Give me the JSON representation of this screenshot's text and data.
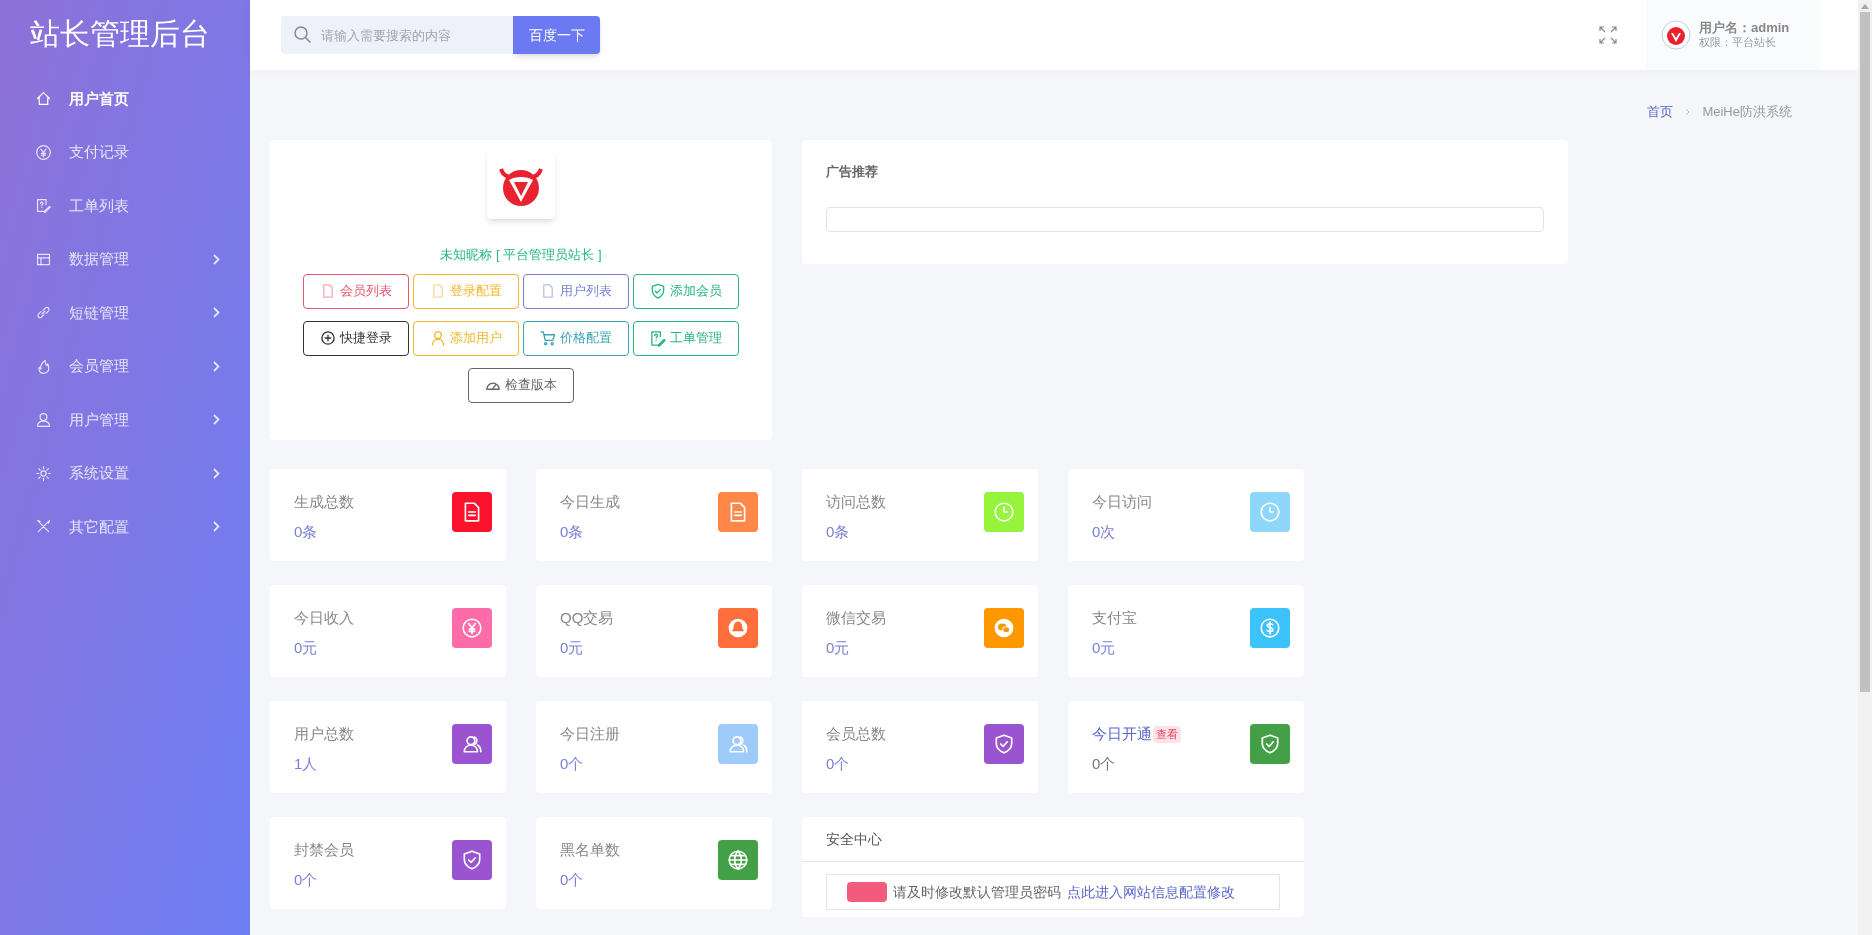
{
  "sidebar": {
    "title": "站长管理后台",
    "items": [
      {
        "label": "用户首页",
        "selected": true,
        "expandable": false
      },
      {
        "label": "支付记录",
        "selected": false,
        "expandable": false
      },
      {
        "label": "工单列表",
        "selected": false,
        "expandable": false
      },
      {
        "label": "数据管理",
        "selected": false,
        "expandable": true
      },
      {
        "label": "短链管理",
        "selected": false,
        "expandable": true
      },
      {
        "label": "会员管理",
        "selected": false,
        "expandable": true
      },
      {
        "label": "用户管理",
        "selected": false,
        "expandable": true
      },
      {
        "label": "系统设置",
        "selected": false,
        "expandable": true
      },
      {
        "label": "其它配置",
        "selected": false,
        "expandable": true
      }
    ]
  },
  "header": {
    "search": {
      "placeholder": "请输入需要搜索的内容"
    },
    "search_button": "百度一下",
    "user": {
      "name_line": "用户名：admin",
      "role_line": "权限：平台站长"
    }
  },
  "breadcrumb": [
    "首页",
    "MeiHe防洪系统"
  ],
  "profile": {
    "nickname": "未知昵称 [ 平台管理员站长 ]",
    "buttons": [
      {
        "label": "会员列表",
        "color": "#e5586f"
      },
      {
        "label": "登录配置",
        "color": "#f3b62a"
      },
      {
        "label": "用户列表",
        "color": "#7b7fd8"
      },
      {
        "label": "添加会员",
        "color": "#27b584"
      },
      {
        "label": "快捷登录",
        "color": "#333333"
      },
      {
        "label": "添加用户",
        "color": "#f3b62a"
      },
      {
        "label": "价格配置",
        "color": "#3aa5b8"
      },
      {
        "label": "工单管理",
        "color": "#27b584"
      },
      {
        "label": "检查版本",
        "color": "#666666"
      }
    ]
  },
  "ad_panel": {
    "title": "广告推荐"
  },
  "stats": [
    {
      "label": "生成总数",
      "value": "0条",
      "color": "#f9132d",
      "kind": "plain"
    },
    {
      "label": "今日生成",
      "value": "0条",
      "color": "#ff8748",
      "kind": "plain"
    },
    {
      "label": "访问总数",
      "value": "0条",
      "color": "#96f43c",
      "kind": "plain"
    },
    {
      "label": "今日访问",
      "value": "0次",
      "color": "#8fd6fb",
      "kind": "plain"
    },
    {
      "label": "今日收入",
      "value": "0元",
      "color": "#fb6ca8",
      "kind": "plain"
    },
    {
      "label": "QQ交易",
      "value": "0元",
      "color": "#ff6e3c",
      "kind": "plain"
    },
    {
      "label": "微信交易",
      "value": "0元",
      "color": "#ff9800",
      "kind": "plain"
    },
    {
      "label": "支付宝",
      "value": "0元",
      "color": "#3cc3fb",
      "kind": "plain"
    },
    {
      "label": "用户总数",
      "value": "1人",
      "color": "#9a54d0",
      "kind": "plain"
    },
    {
      "label": "今日注册",
      "value": "0个",
      "color": "#9fcbfb",
      "kind": "plain"
    },
    {
      "label": "会员总数",
      "value": "0个",
      "color": "#9a54d0",
      "kind": "plain"
    },
    {
      "label": "今日开通",
      "value": "0个",
      "color": "#43a047",
      "kind": "link",
      "badge": "查看"
    },
    {
      "label": "封禁会员",
      "value": "0个",
      "color": "#9a54d0",
      "kind": "plain"
    },
    {
      "label": "黑名单数",
      "value": "0个",
      "color": "#43a047",
      "kind": "plain"
    }
  ],
  "security": {
    "title": "安全中心",
    "notice": "请及时修改默认管理员密码",
    "link": "点此进入网站信息配置修改"
  }
}
